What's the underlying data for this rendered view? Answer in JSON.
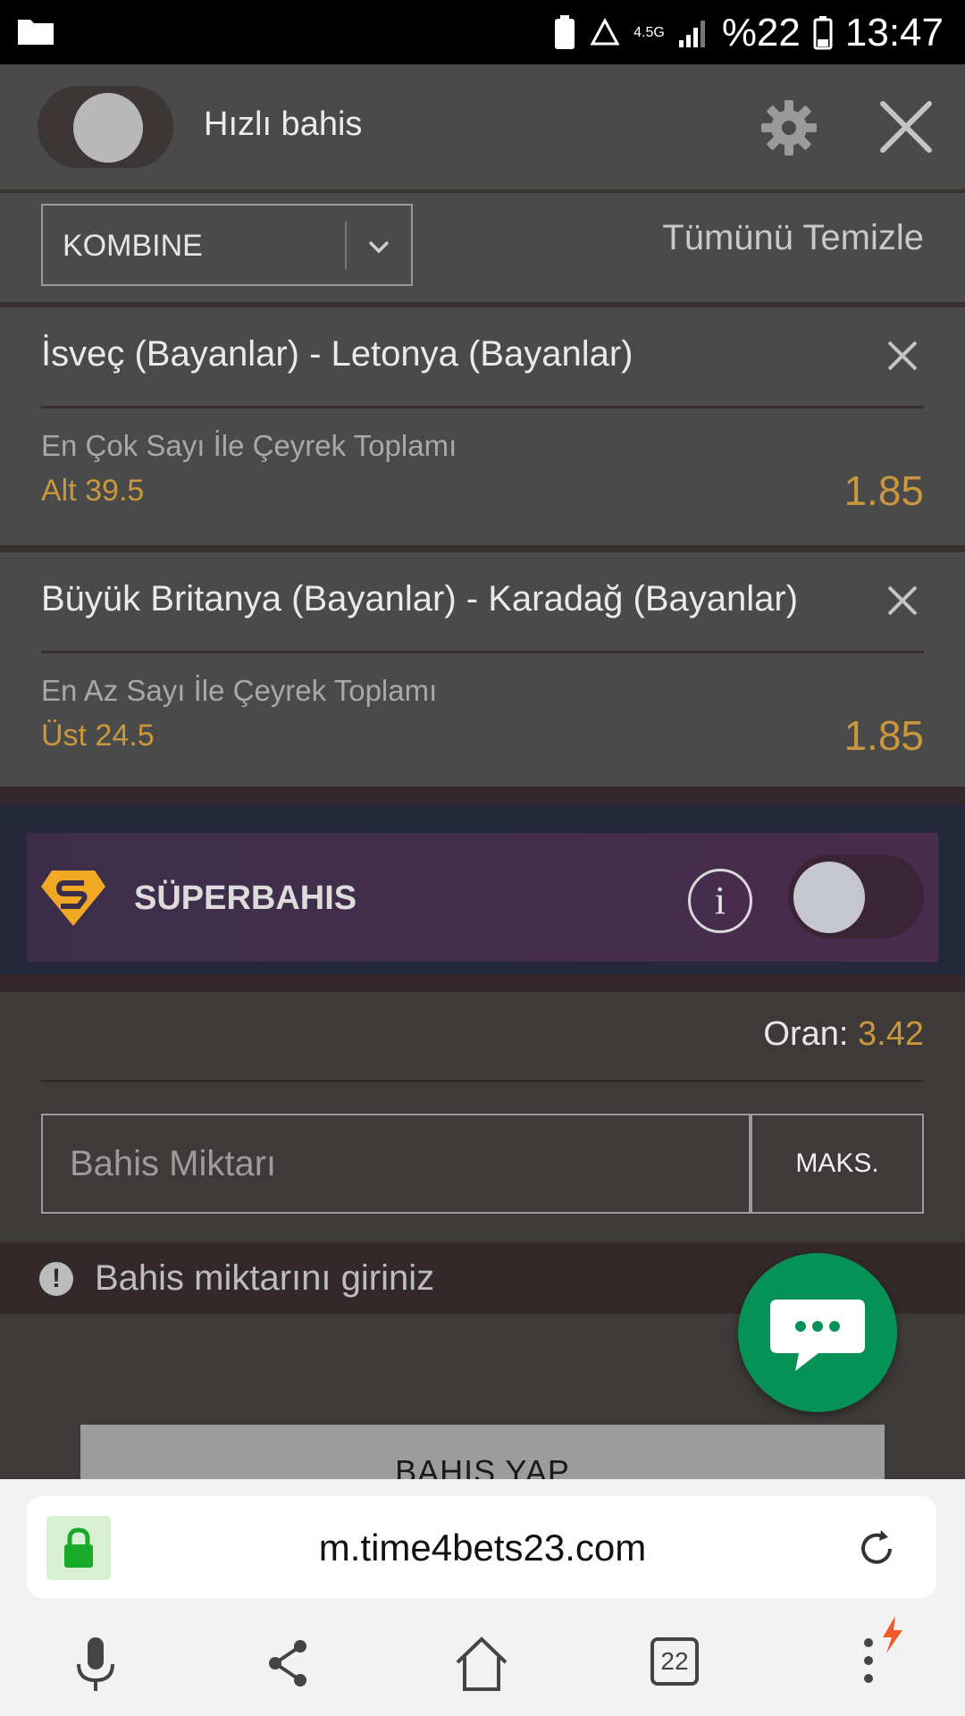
{
  "status_bar": {
    "battery_percent": "%22",
    "time": "13:47",
    "network": "4.5G"
  },
  "header": {
    "quick_bet_label": "Hızlı bahis"
  },
  "toolbar": {
    "bet_type": "KOMBINE",
    "clear_all": "Tümünü Temizle"
  },
  "bets": [
    {
      "match": "İsveç (Bayanlar) - Letonya (Bayanlar)",
      "market": "En Çok Sayı İle Çeyrek Toplamı",
      "selection": "Alt 39.5",
      "odds": "1.85"
    },
    {
      "match": "Büyük Britanya (Bayanlar) - Karadağ (Bayanlar)",
      "market": "En Az Sayı İle Çeyrek Toplamı",
      "selection": "Üst 24.5",
      "odds": "1.85"
    }
  ],
  "superbahis": {
    "label": "SÜPERBAHIS",
    "info_glyph": "i"
  },
  "summary": {
    "odds_label": "Oran:",
    "odds_value": "3.42"
  },
  "stake": {
    "placeholder": "Bahis Miktarı",
    "max_label": "MAKS."
  },
  "warning": {
    "text": "Bahis miktarını giriniz",
    "icon": "!"
  },
  "place_bet": {
    "label": "BAHIS YAP"
  },
  "browser": {
    "url": "m.time4bets23.com",
    "tabs_count": "22"
  },
  "colors": {
    "accent": "#c9973c",
    "chat": "#069157",
    "panel": "#4a4a4a"
  }
}
